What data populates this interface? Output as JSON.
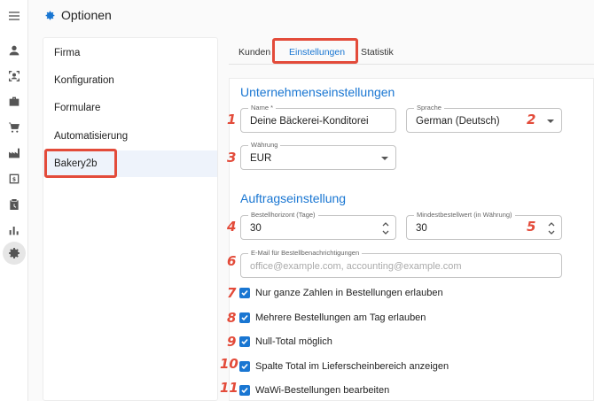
{
  "header": {
    "title": "Optionen"
  },
  "subnav": {
    "items": [
      {
        "label": "Firma"
      },
      {
        "label": "Konfiguration"
      },
      {
        "label": "Formulare"
      },
      {
        "label": "Automatisierung"
      },
      {
        "label": "Bakery2b"
      }
    ]
  },
  "tabs": [
    {
      "label": "Kunden"
    },
    {
      "label": "Einstellungen"
    },
    {
      "label": "Statistik"
    }
  ],
  "company": {
    "title": "Unternehmenseinstellungen",
    "name_label": "Name *",
    "name_value": "Deine Bäckerei-Konditorei",
    "language_label": "Sprache",
    "language_value": "German (Deutsch)",
    "currency_label": "Währung",
    "currency_value": "EUR"
  },
  "order": {
    "title": "Auftragseinstellung",
    "horizon_label": "Bestellhorizont (Tage)",
    "horizon_value": "30",
    "min_order_label": "Mindestbestellwert (in Währung)",
    "min_order_value": "30",
    "email_label": "E-Mail für Bestellbenachrichtigungen",
    "email_placeholder": "office@example.com, accounting@example.com"
  },
  "checkboxes": [
    {
      "label": "Nur ganze Zahlen in Bestellungen erlauben",
      "checked": true
    },
    {
      "label": "Mehrere Bestellungen am Tag erlauben",
      "checked": true
    },
    {
      "label": "Null-Total möglich",
      "checked": true
    },
    {
      "label": "Spalte Total im Lieferscheinbereich anzeigen",
      "checked": true
    },
    {
      "label": "WaWi-Bestellungen bearbeiten",
      "checked": true
    }
  ],
  "annotations": [
    "1",
    "2",
    "3",
    "4",
    "5",
    "6",
    "7",
    "8",
    "9",
    "10",
    "11"
  ],
  "colors": {
    "accent": "#1976d2",
    "highlight": "#e34b3a"
  },
  "icons": {
    "rail": [
      "menu-icon",
      "person-icon",
      "face-scan-icon",
      "briefcase-icon",
      "cart-icon",
      "factory-icon",
      "invoice-icon",
      "clipboard-icon",
      "bar-chart-icon",
      "gear-icon"
    ],
    "header": "gear-icon"
  }
}
